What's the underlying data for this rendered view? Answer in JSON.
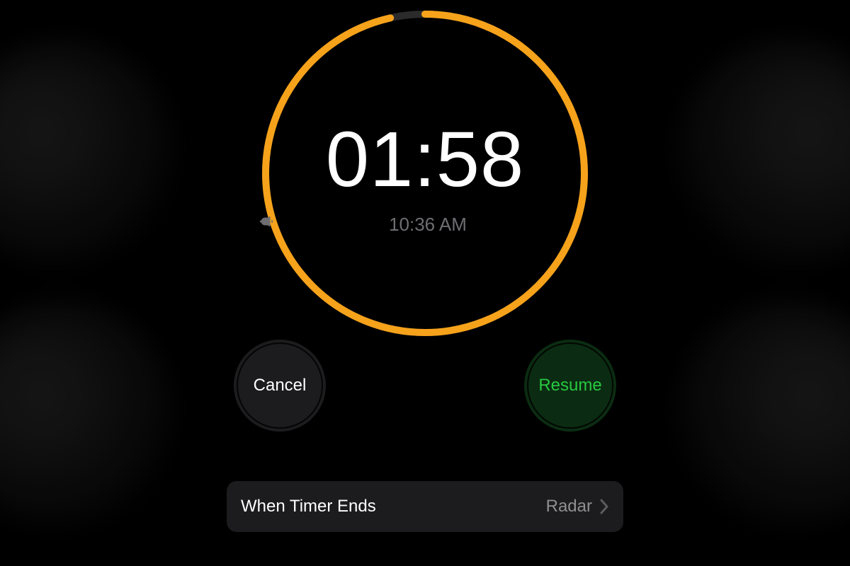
{
  "timer": {
    "remaining": "01:58",
    "end_time": "10:36 AM",
    "ring_progress": 0.965,
    "ring_color": "#f6a21b"
  },
  "buttons": {
    "cancel_label": "Cancel",
    "resume_label": "Resume"
  },
  "settings_row": {
    "label": "When Timer Ends",
    "value": "Radar"
  }
}
